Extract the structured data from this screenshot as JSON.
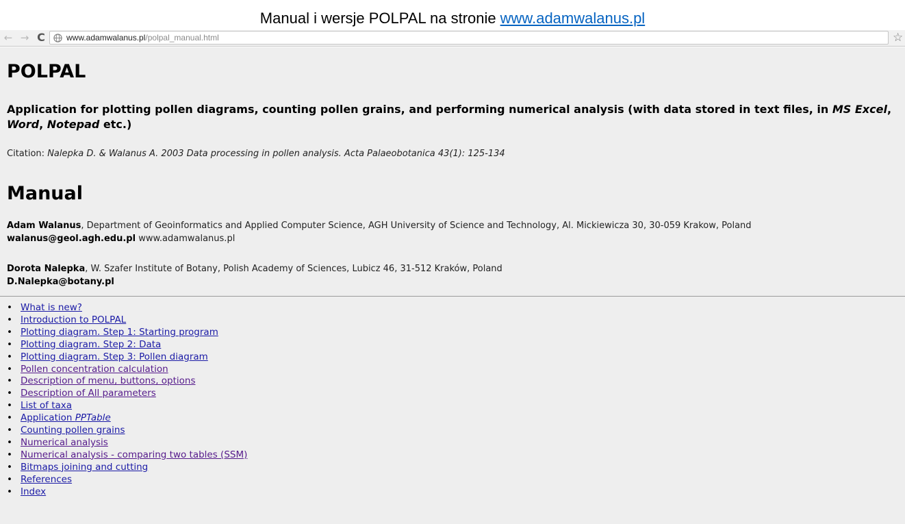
{
  "caption": {
    "text": "Manual i wersje POLPAL na stronie",
    "link": "www.adamwalanus.pl"
  },
  "browser": {
    "back_icon": "back-arrow-icon",
    "forward_icon": "forward-arrow-icon",
    "reload_icon": "reload-icon",
    "site_icon": "globe-icon",
    "url_host": "www.adamwalanus.pl",
    "url_path": "/polpal_manual.html",
    "bookmark_icon": "star-icon"
  },
  "page": {
    "title": "POLPAL",
    "subtitle": {
      "part1": "Application for plotting pollen diagrams, counting pollen grains, and performing numerical analysis (with data stored in text files, in ",
      "ms_excel": "MS Excel",
      "sep1": ", ",
      "word": "Word",
      "sep2": ", ",
      "notepad": "Notepad",
      "part2": " etc.)"
    },
    "citation": {
      "label": "Citation:",
      "reference": "Nalepka D. & Walanus A. 2003 Data processing in pollen analysis. Acta Palaeobotanica 43(1): 125-134"
    },
    "manual_heading": "Manual",
    "authors": [
      {
        "name": "Adam Walanus",
        "affiliation": ", Department of Geoinformatics and Applied Computer Science, AGH University of Science and Technology, Al. Mickiewicza 30, 30-059 Krakow, Poland",
        "email": "walanus@geol.agh.edu.pl",
        "website": " www.adamwalanus.pl"
      },
      {
        "name": "Dorota Nalepka",
        "affiliation": ", W. Szafer Institute of Botany, Polish Academy of Sciences, Lubicz 46, 31-512 Kraków, Poland",
        "email": "D.Nalepka@botany.pl"
      }
    ],
    "toc": [
      {
        "label": "What is new?"
      },
      {
        "label": "Introduction to POLPAL"
      },
      {
        "label": "Plotting diagram. Step 1: Starting program"
      },
      {
        "label": "Plotting diagram. Step 2: Data"
      },
      {
        "label": "Plotting diagram. Step 3: Pollen diagram"
      },
      {
        "label": "Pollen concentration calculation"
      },
      {
        "label": "Description of menu, buttons, options"
      },
      {
        "label": "Description of All parameters"
      },
      {
        "label": "List of taxa"
      },
      {
        "label": "Application ",
        "label_italic": "PPTable"
      },
      {
        "label": "Counting pollen grains"
      },
      {
        "label": "Numerical analysis"
      },
      {
        "label": "Numerical analysis - comparing two tables (SSM)"
      },
      {
        "label": "Bitmaps joining and cutting"
      },
      {
        "label": "References"
      },
      {
        "label": "Index"
      }
    ],
    "bullet": "•"
  },
  "colors": {
    "link": "#1a1aa6",
    "visited_link": "#551a8b",
    "caption_link": "#0563c1",
    "page_background": "#eeeeee"
  }
}
